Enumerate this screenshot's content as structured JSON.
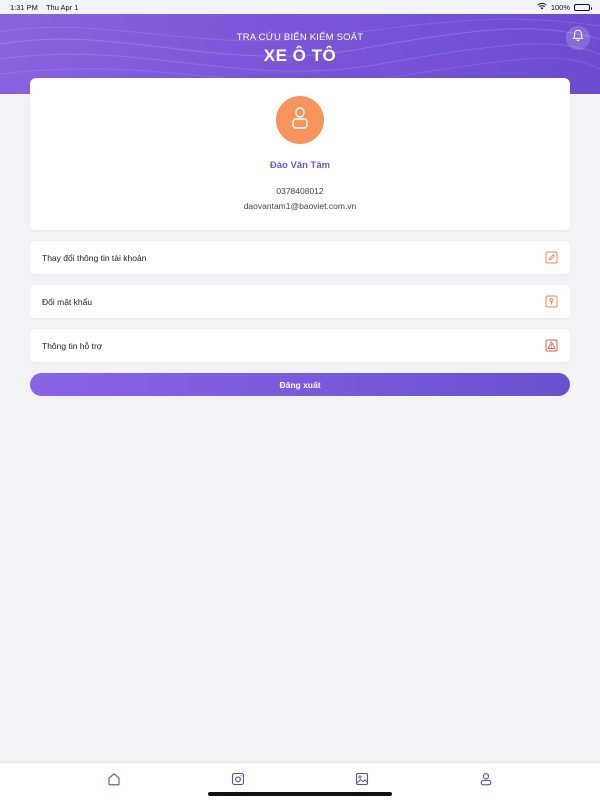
{
  "status_bar": {
    "time": "1:31 PM",
    "date": "Thu Apr 1",
    "battery": "100%"
  },
  "header": {
    "subtitle": "TRA CỨU BIỂN KIỂM SOÁT",
    "title": "XE Ô TÔ",
    "bell_icon": "bell-icon"
  },
  "profile": {
    "avatar_icon": "user-icon",
    "name": "Đào Văn Tâm",
    "phone": "0378408012",
    "email": "daovantam1@baoviet.com.vn"
  },
  "menu": {
    "items": [
      {
        "label": "Thay đổi thông tin tài khoản",
        "icon": "edit-icon"
      },
      {
        "label": "Đổi mật khẩu",
        "icon": "key-icon"
      },
      {
        "label": "Thông tin hỗ trợ",
        "icon": "warning-icon"
      }
    ]
  },
  "logout": {
    "label": "Đăng xuất"
  },
  "tab_bar": {
    "tabs": [
      {
        "icon": "home-icon"
      },
      {
        "icon": "camera-icon"
      },
      {
        "icon": "image-icon"
      },
      {
        "icon": "profile-icon"
      }
    ]
  },
  "colors": {
    "accent": "#7a55d8",
    "avatar": "#f5955b",
    "icon_orange": "#f0894f",
    "icon_red": "#e55a4a"
  }
}
